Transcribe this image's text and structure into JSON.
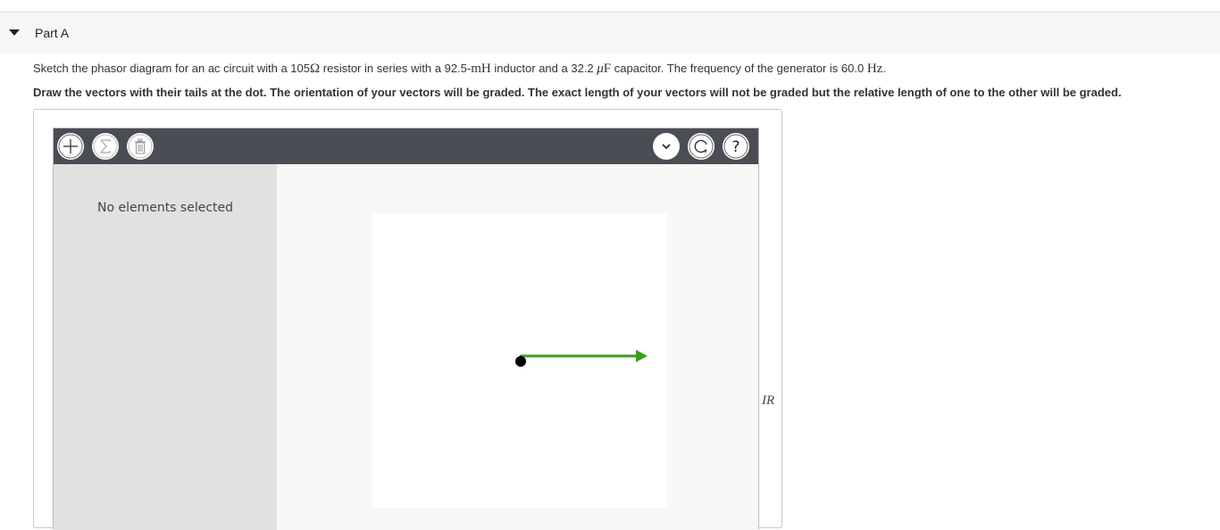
{
  "part": {
    "title": "Part A"
  },
  "question": {
    "prompt_segments": [
      "Sketch the phasor diagram for an ac circuit with a 105",
      "Ω",
      " resistor in series with a 92.5-",
      "mH",
      " inductor and a 32.2 ",
      "μ",
      "F",
      " capacitor. The frequency of the generator is 60.0 ",
      "Hz",
      "."
    ],
    "instruction": "Draw the vectors with their tails at the dot. The orientation of your vectors will be graded. The exact length of your vectors will not be graded but the relative length of one to the other will be graded."
  },
  "toolbar": {
    "left_buttons": [
      "plus-icon",
      "sigma-icon",
      "trash-icon"
    ],
    "right_buttons": [
      "chevron-down-icon",
      "reset-icon",
      "help-icon"
    ],
    "help_glyph": "?"
  },
  "sidebar": {
    "empty_message": "No elements selected"
  },
  "vectors": [
    {
      "label": "IR",
      "direction_deg": 0,
      "color": "#3c9e1e"
    }
  ],
  "colors": {
    "toolbar_bg": "#4b4d55",
    "sidebar_bg": "#e1e1e1",
    "vector_green": "#3c9e1e",
    "origin_dot": "#000000"
  }
}
